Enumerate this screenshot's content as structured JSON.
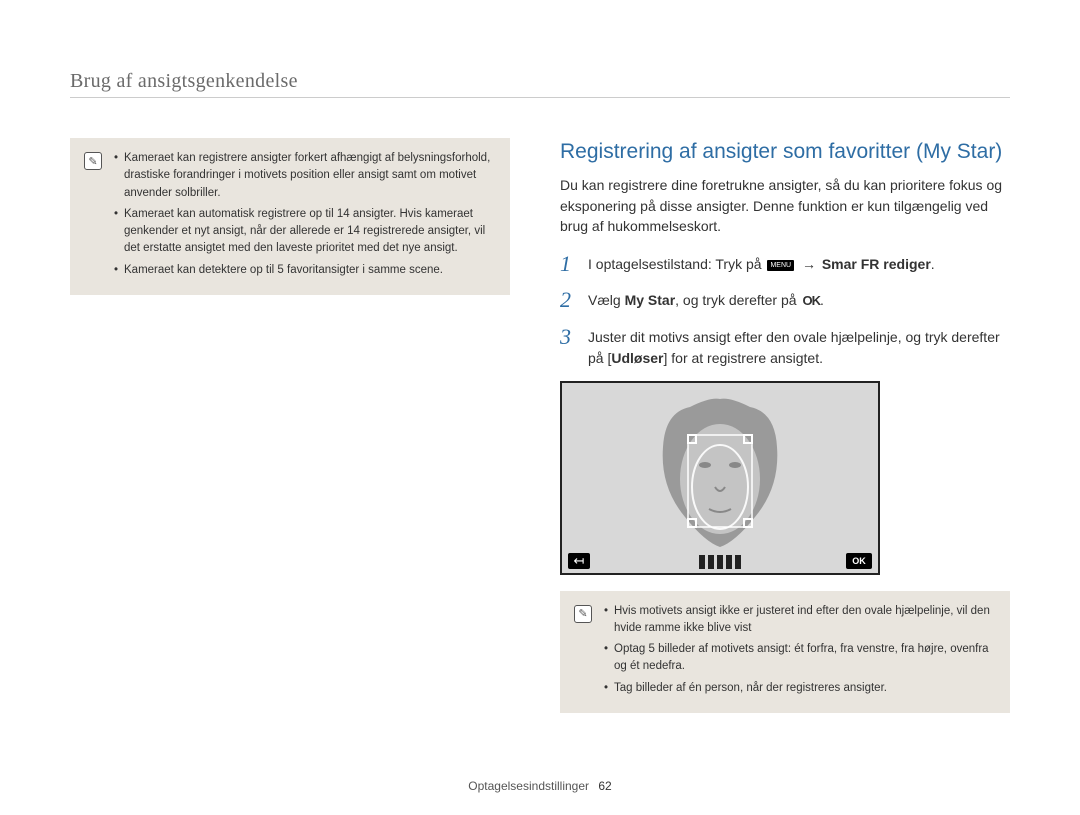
{
  "page_title": "Brug af ansigtsgenkendelse",
  "left_notes": [
    "Kameraet kan registrere ansigter forkert afhængigt af belysningsforhold, drastiske forandringer i motivets position eller ansigt samt om motivet anvender solbriller.",
    "Kameraet kan automatisk registrere op til 14 ansigter. Hvis kameraet genkender et nyt ansigt, når der allerede er 14 registrerede ansigter, vil det erstatte ansigtet med den laveste prioritet med det nye ansigt.",
    "Kameraet kan detektere op til 5 favoritansigter i samme scene."
  ],
  "section_heading": "Registrering af ansigter som favoritter (My Star)",
  "intro_text": "Du kan registrere dine foretrukne ansigter, så du kan prioritere fokus og eksponering på disse ansigter. Denne funktion er kun tilgængelig ved brug af hukommelseskort.",
  "steps": {
    "s1": {
      "num": "1",
      "prefix": "I optagelsestilstand: Tryk på ",
      "menu_label": "MENU",
      "arrow": "→",
      "bold": "Smar FR rediger",
      "suffix": "."
    },
    "s2": {
      "num": "2",
      "prefix": "Vælg ",
      "bold": "My Star",
      "mid": ", og tryk derefter på ",
      "ok_label": "OK",
      "suffix": "."
    },
    "s3": {
      "num": "3",
      "prefix": "Juster dit motivs ansigt efter den ovale hjælpelinje, og tryk derefter på [",
      "bold": "Udløser",
      "suffix": "] for at registrere ansigtet."
    }
  },
  "camera": {
    "back_glyph": "↤",
    "ok_label": "OK"
  },
  "right_notes": [
    "Hvis motivets ansigt ikke er justeret ind efter den ovale hjælpelinje, vil den hvide ramme ikke blive vist",
    "Optag 5 billeder af motivets ansigt: ét forfra, fra venstre, fra højre, ovenfra og ét nedefra.",
    "Tag billeder af én person, når der registreres ansigter."
  ],
  "footer": {
    "section": "Optagelsesindstillinger",
    "page_num": "62"
  },
  "note_icon_glyph": "✎"
}
